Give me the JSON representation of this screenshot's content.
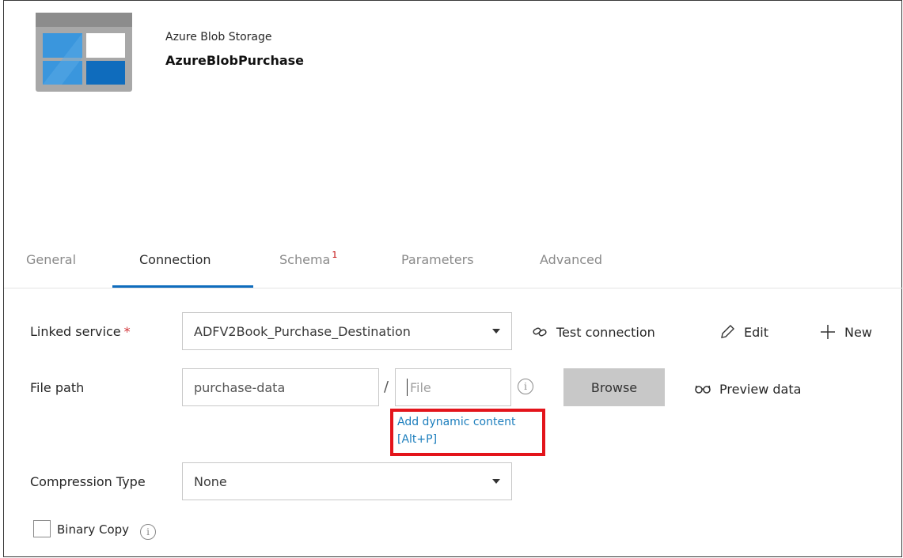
{
  "dataset": {
    "type_label": "Azure Blob Storage",
    "name": "AzureBlobPurchase",
    "icon": "azure-blob-storage-icon"
  },
  "tabs": [
    {
      "label": "General",
      "active": false
    },
    {
      "label": "Connection",
      "active": true
    },
    {
      "label": "Schema",
      "badge": "1",
      "active": false
    },
    {
      "label": "Parameters",
      "active": false
    },
    {
      "label": "Advanced",
      "active": false
    }
  ],
  "linked_service": {
    "label": "Linked service",
    "required_mark": "*",
    "value": "ADFV2Book_Purchase_Destination",
    "actions": {
      "test_connection": "Test connection",
      "edit": "Edit",
      "new": "New"
    }
  },
  "file_path": {
    "label": "File path",
    "container_value": "purchase-data",
    "separator": "/",
    "file_placeholder": "File",
    "browse_label": "Browse",
    "preview_label": "Preview data",
    "dynamic_content_line1": "Add dynamic content",
    "dynamic_content_line2": "[Alt+P]"
  },
  "compression": {
    "label": "Compression Type",
    "value": "None"
  },
  "binary_copy": {
    "label": "Binary Copy",
    "checked": false
  },
  "colors": {
    "accent": "#0f6cbd",
    "link": "#1c7ebd",
    "highlight": "#e3141b",
    "required": "#d13438"
  }
}
